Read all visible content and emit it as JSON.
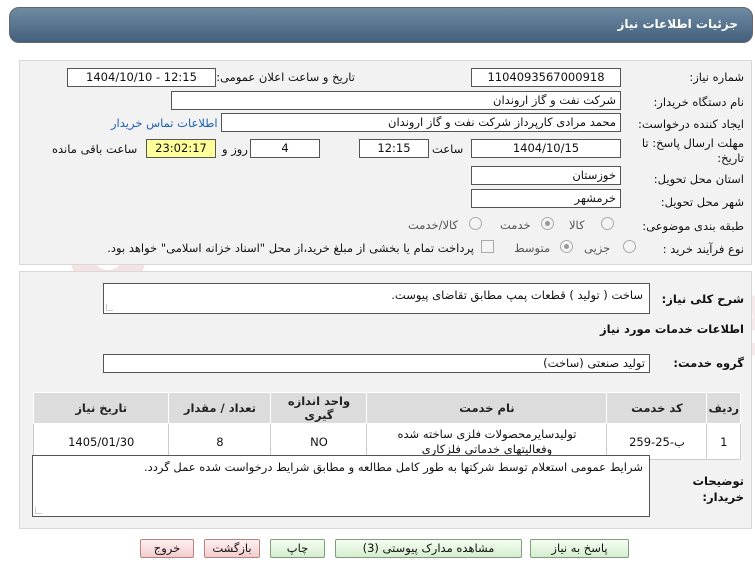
{
  "header": {
    "title": "جزئیات اطلاعات نیاز"
  },
  "form": {
    "need_number_label": "شماره نیاز:",
    "need_number": "1104093567000918",
    "announce_label": "تاریخ و ساعت اعلان عمومی:",
    "announce_value": "1404/10/10 - 12:15",
    "buyer_org_label": "نام دستگاه خریدار:",
    "buyer_org": "شرکت نفت و گاز اروندان",
    "creator_label": "ایجاد کننده درخواست:",
    "creator": "محمد مرادی کارپرداز شرکت نفت و گاز اروندان",
    "contact_link": "اطلاعات تماس خریدار",
    "deadline_label": "مهلت ارسال پاسخ: تا تاریخ:",
    "deadline_date": "1404/10/15",
    "time_label": "ساعت",
    "deadline_time": "12:15",
    "days_value": "4",
    "days_label": "روز و",
    "remaining_time": "23:02:17",
    "remaining_label": "ساعت باقی مانده",
    "province_label": "استان محل تحویل:",
    "province": "خوزستان",
    "city_label": "شهر محل تحویل:",
    "city": "خرمشهر",
    "category_label": "طبقه بندی موضوعی:",
    "category_options": [
      "کالا",
      "خدمت",
      "کالا/خدمت"
    ],
    "category_selected": "خدمت",
    "process_label": "نوع فرآیند خرید :",
    "process_options": [
      "جزیی",
      "متوسط"
    ],
    "process_selected": "متوسط",
    "payment_note": "پرداخت تمام یا بخشی از مبلغ خرید،از محل \"اسناد خزانه اسلامی\" خواهد بود."
  },
  "description": {
    "label": "شرح کلی نیاز:",
    "text": "ساخت ( تولید ) قطعات پمپ مطابق تقاضای پیوست."
  },
  "services": {
    "section_title": "اطلاعات خدمات مورد نیاز",
    "group_label": "گروه خدمت:",
    "group_value": "تولید صنعتی (ساخت)",
    "columns": [
      "ردیف",
      "کد خدمت",
      "نام خدمت",
      "واحد اندازه گیری",
      "تعداد / مقدار",
      "تاریخ نیاز"
    ],
    "rows": [
      [
        "1",
        "ب-25-259",
        "تولیدسایرمحصولات فلزی ساخته شده وفعالیتهای خدماتی فلزکاری",
        "NO",
        "8",
        "1405/01/30"
      ]
    ]
  },
  "buyer_notes": {
    "label": "توضیحات خریدار:",
    "text": "شرایط عمومی استعلام توسط شرکتها به طور کامل مطالعه و مطابق شرایط درخواست شده عمل گردد."
  },
  "buttons": {
    "reply": "پاسخ به نیاز",
    "view_docs": "مشاهده مدارک پیوستی (3)",
    "print": "چاپ",
    "back": "بازگشت",
    "exit": "خروج"
  },
  "watermark": {
    "text": "AriaTender.net"
  },
  "colors": {
    "header": "#43607c",
    "highlight": "#ffff99",
    "link": "#1a5fb4"
  }
}
